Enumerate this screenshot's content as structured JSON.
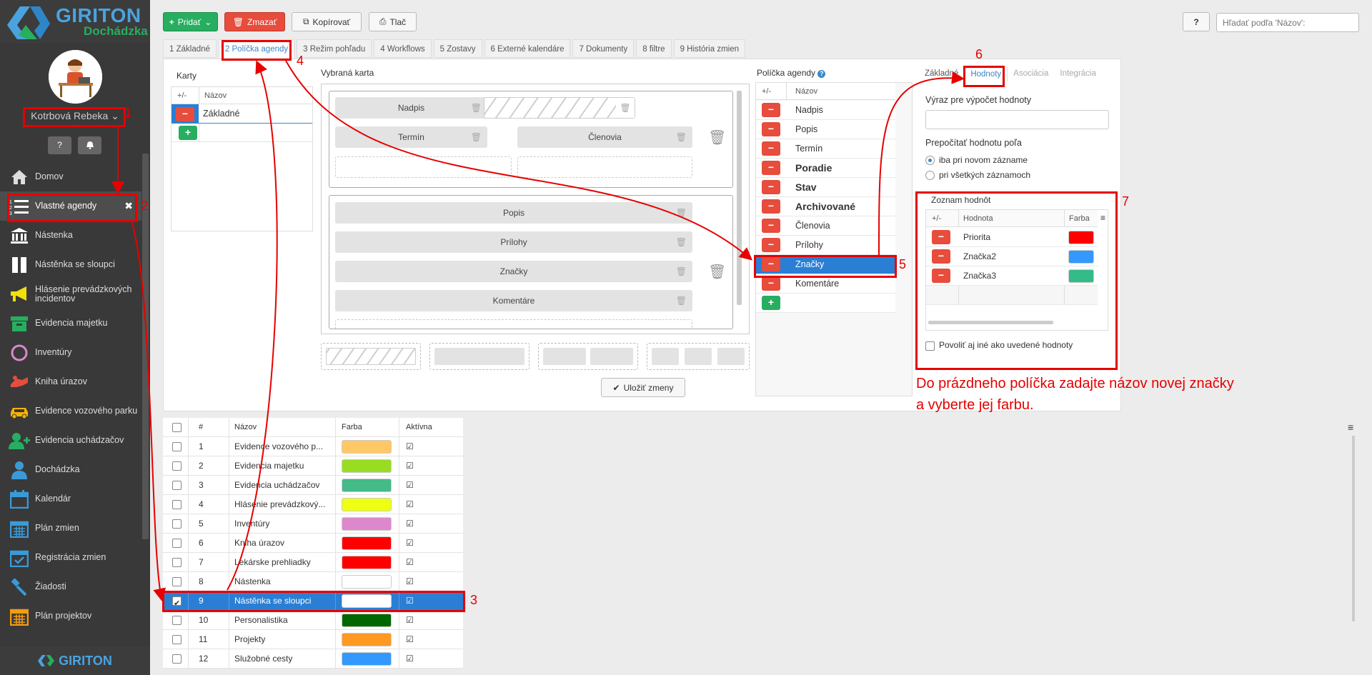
{
  "brand": {
    "name": "GIRITON",
    "sub": "Dochádzka",
    "footer": "GIRITON"
  },
  "user": {
    "name": "Kotrbová Rebeka"
  },
  "sidebar": {
    "items": [
      {
        "label": "Domov",
        "icon": "home-icon"
      },
      {
        "label": "Vlastné agendy",
        "icon": "list-icon",
        "active": true
      },
      {
        "label": "Nástenka",
        "icon": "bank-icon"
      },
      {
        "label": "Nástěnka se sloupci",
        "icon": "columns-icon"
      },
      {
        "label": "Hlásenie prevádzkových incidentov",
        "icon": "megaphone-icon"
      },
      {
        "label": "Evidencia majetku",
        "icon": "box-icon"
      },
      {
        "label": "Inventúry",
        "icon": "circle-icon"
      },
      {
        "label": "Kniha úrazov",
        "icon": "injury-icon"
      },
      {
        "label": "Evidence vozového parku",
        "icon": "car-icon"
      },
      {
        "label": "Evidencia uchádzačov",
        "icon": "user-plus-icon"
      },
      {
        "label": "Dochádzka",
        "icon": "user-icon"
      },
      {
        "label": "Kalendár",
        "icon": "calendar-icon"
      },
      {
        "label": "Plán zmien",
        "icon": "calendar-grid-icon"
      },
      {
        "label": "Registrácia zmien",
        "icon": "calendar-check-icon"
      },
      {
        "label": "Žiadosti",
        "icon": "gavel-icon"
      },
      {
        "label": "Plán projektov",
        "icon": "calendar-orange-icon"
      }
    ]
  },
  "toolbar": {
    "add": "Pridať",
    "delete": "Zmazať",
    "copy": "Kopírovať",
    "print": "Tlač",
    "help": "?"
  },
  "search": {
    "placeholder": "Hľadať podľa 'Názov':"
  },
  "tabs": [
    "1 Základné",
    "2 Políčka agendy",
    "3 Režim pohľadu",
    "4 Workflows",
    "5 Zostavy",
    "6 Externé kalendáre",
    "7 Dokumenty",
    "8 filtre",
    "9 História zmien"
  ],
  "cards": {
    "title": "Karty",
    "col_pm": "+/-",
    "col_name": "Názov",
    "rows": [
      "Základné"
    ]
  },
  "selected_card": {
    "title": "Vybraná karta",
    "group1": [
      "Nadpis",
      "Termín",
      "Členovia"
    ],
    "group2": [
      "Popis",
      "Prílohy",
      "Značky",
      "Komentáre"
    ]
  },
  "fields": {
    "title": "Políčka agendy",
    "help": "?",
    "col_pm": "+/-",
    "col_name": "Názov",
    "rows": [
      {
        "name": "Nadpis",
        "bold": false
      },
      {
        "name": "Popis",
        "bold": false
      },
      {
        "name": "Termín",
        "bold": false
      },
      {
        "name": "Poradie",
        "bold": true
      },
      {
        "name": "Stav",
        "bold": true
      },
      {
        "name": "Archivované",
        "bold": true
      },
      {
        "name": "Členovia",
        "bold": false
      },
      {
        "name": "Prílohy",
        "bold": false
      },
      {
        "name": "Značky",
        "bold": false,
        "selected": true
      },
      {
        "name": "Komentáre",
        "bold": false
      }
    ]
  },
  "detail": {
    "tabs": [
      "Základné",
      "Hodnoty",
      "Asociácia",
      "Integrácia"
    ],
    "expr_label": "Výraz pre výpočet hodnoty",
    "recalc_label": "Prepočítať hodnotu poľa",
    "opt1": "iba pri novom zázname",
    "opt2": "pri všetkých záznamoch",
    "list_title": "Zoznam hodnôt",
    "col_pm": "+/-",
    "col_value": "Hodnota",
    "col_color": "Farba",
    "values": [
      {
        "name": "Priorita",
        "color": "#ff0000"
      },
      {
        "name": "Značka2",
        "color": "#3399ff"
      },
      {
        "name": "Značka3",
        "color": "#33bb88"
      }
    ],
    "allow_other": "Povoliť aj iné ako uvedené hodnoty"
  },
  "save_button": "Uložiť zmeny",
  "annotation": {
    "line1": "Do prázdneho políčka zadajte názov novej značky",
    "line2": "a vyberte jej farbu."
  },
  "markers": [
    "1",
    "2",
    "3",
    "4",
    "5",
    "6",
    "7"
  ],
  "agenda_table": {
    "headers": [
      "#",
      "Názov",
      "Farba",
      "Aktívna"
    ],
    "rows": [
      {
        "n": "1",
        "name": "Evidence vozového p...",
        "color": "#ffc864"
      },
      {
        "n": "2",
        "name": "Evidencia majetku",
        "color": "#99dd22"
      },
      {
        "n": "3",
        "name": "Evidencia uchádzačov",
        "color": "#44bb88"
      },
      {
        "n": "4",
        "name": "Hlásenie prevádzkový...",
        "color": "#eeff11"
      },
      {
        "n": "5",
        "name": "Inventúry",
        "color": "#dd88cc"
      },
      {
        "n": "6",
        "name": "Kniha úrazov",
        "color": "#ff0000"
      },
      {
        "n": "7",
        "name": "Lekárske prehliadky",
        "color": "#ff0000"
      },
      {
        "n": "8",
        "name": "Nástenka",
        "color": "#ffffff"
      },
      {
        "n": "9",
        "name": "Nástěnka se sloupci",
        "color": "#ffffff",
        "selected": true
      },
      {
        "n": "10",
        "name": "Personalistika",
        "color": "#006600"
      },
      {
        "n": "11",
        "name": "Projekty",
        "color": "#ff9922"
      },
      {
        "n": "12",
        "name": "Služobné cesty",
        "color": "#3399ff"
      }
    ]
  },
  "colors": {
    "accent": "#2a7fd4",
    "red": "#e74c3c",
    "green": "#27ae60",
    "annotation": "#e60000"
  }
}
